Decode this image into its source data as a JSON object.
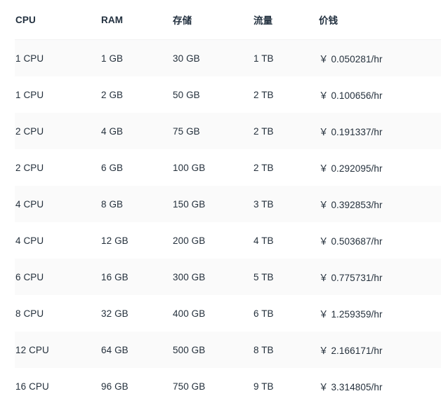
{
  "table": {
    "columns": [
      {
        "key": "cpu",
        "label": "CPU",
        "name": "column-header-cpu"
      },
      {
        "key": "ram",
        "label": "RAM",
        "name": "column-header-ram"
      },
      {
        "key": "storage",
        "label": "存储",
        "name": "column-header-storage"
      },
      {
        "key": "traffic",
        "label": "流量",
        "name": "column-header-traffic"
      },
      {
        "key": "price",
        "label": "价钱",
        "name": "column-header-price"
      }
    ],
    "rows": [
      {
        "cpu": "1 CPU",
        "ram": "1 GB",
        "storage": "30 GB",
        "traffic": "1 TB",
        "price": "￥ 0.050281/hr",
        "shaded": true
      },
      {
        "cpu": "1 CPU",
        "ram": "2 GB",
        "storage": "50 GB",
        "traffic": "2 TB",
        "price": "￥ 0.100656/hr",
        "shaded": false
      },
      {
        "cpu": "2 CPU",
        "ram": "4 GB",
        "storage": "75 GB",
        "traffic": "2 TB",
        "price": "￥ 0.191337/hr",
        "shaded": true
      },
      {
        "cpu": "2 CPU",
        "ram": "6 GB",
        "storage": "100 GB",
        "traffic": "2 TB",
        "price": "￥ 0.292095/hr",
        "shaded": false
      },
      {
        "cpu": "4 CPU",
        "ram": "8 GB",
        "storage": "150 GB",
        "traffic": "3 TB",
        "price": "￥ 0.392853/hr",
        "shaded": true
      },
      {
        "cpu": "4 CPU",
        "ram": "12 GB",
        "storage": "200 GB",
        "traffic": "4 TB",
        "price": "￥ 0.503687/hr",
        "shaded": false
      },
      {
        "cpu": "6 CPU",
        "ram": "16 GB",
        "storage": "300 GB",
        "traffic": "5 TB",
        "price": "￥ 0.775731/hr",
        "shaded": true
      },
      {
        "cpu": "8 CPU",
        "ram": "32 GB",
        "storage": "400 GB",
        "traffic": "6 TB",
        "price": "￥ 1.259359/hr",
        "shaded": false
      },
      {
        "cpu": "12 CPU",
        "ram": "64 GB",
        "storage": "500 GB",
        "traffic": "8 TB",
        "price": "￥ 2.166171/hr",
        "shaded": true
      },
      {
        "cpu": "16 CPU",
        "ram": "96 GB",
        "storage": "750 GB",
        "traffic": "9 TB",
        "price": "￥ 3.314805/hr",
        "shaded": false
      }
    ]
  },
  "colors": {
    "text": "#24303c",
    "header_text": "#22303f",
    "stripe_background": "#fafafa",
    "row_background": "#ffffff",
    "divider": "#f2f2f3"
  }
}
